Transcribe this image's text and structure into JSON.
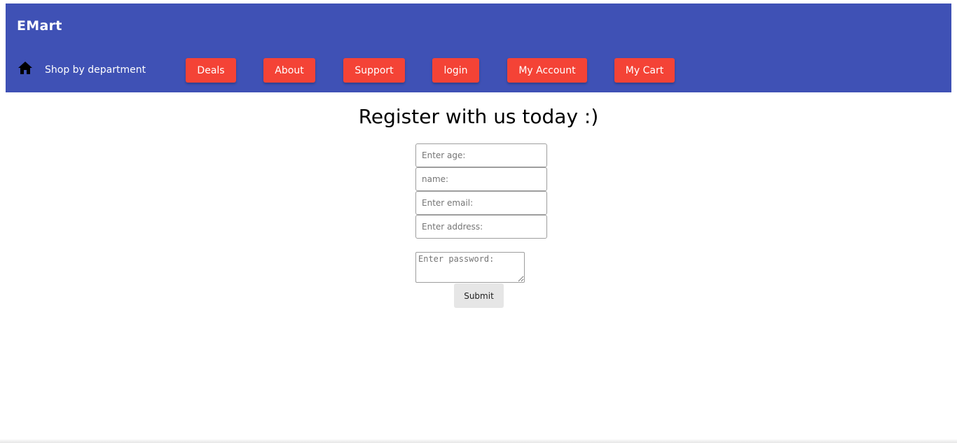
{
  "header": {
    "brand": "EMart",
    "shop_label": "Shop by department",
    "home_icon": "home-icon",
    "bar_color": "#3f51b5",
    "button_color": "#f44336",
    "nav": [
      "Deals",
      "About",
      "Support",
      "login",
      "My Account",
      "My Cart"
    ]
  },
  "main": {
    "heading": "Register with us today :)",
    "fields": {
      "age_placeholder": "Enter age:",
      "name_placeholder": "name:",
      "email_placeholder": "Enter email:",
      "address_placeholder": "Enter address:",
      "password_placeholder": "Enter password:"
    },
    "submit_label": "Submit"
  }
}
